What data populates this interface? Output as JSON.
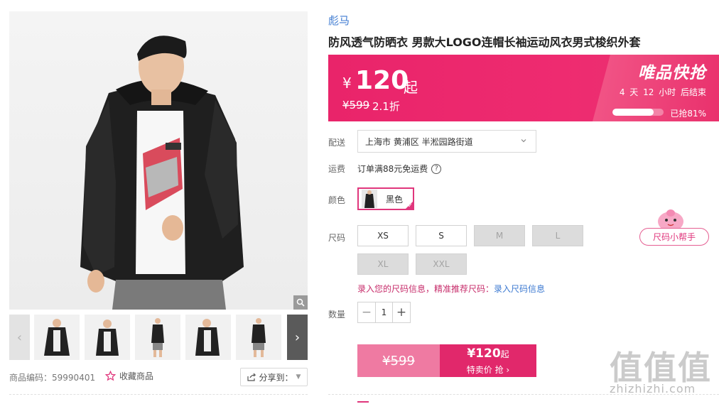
{
  "product": {
    "brand": "彪马",
    "title": "防风透气防晒衣 男款大LOGO连帽长袖运动风衣男式梭织外套"
  },
  "gallery": {
    "sku_label": "商品编码：",
    "sku_code": "59990401",
    "favorite_label": "收藏商品",
    "share_label": "分享到："
  },
  "price": {
    "currency": "¥",
    "amount": "120",
    "suffix": "起",
    "original": "¥599",
    "discount": "2.1折"
  },
  "flash_sale": {
    "title": "唯品快抢",
    "countdown": "4 天 12 小时 后结束",
    "sold_percent": 81,
    "sold_label": "已抢81%"
  },
  "delivery": {
    "label": "配送",
    "value": "上海市 黄浦区 半淞园路街道"
  },
  "shipping": {
    "label": "运费",
    "value": "订单满88元免运费",
    "help": "?"
  },
  "color": {
    "label": "颜色",
    "selected": "黑色"
  },
  "size": {
    "label": "尺码",
    "options": [
      {
        "label": "XS",
        "available": true
      },
      {
        "label": "S",
        "available": true
      },
      {
        "label": "M",
        "available": false
      },
      {
        "label": "L",
        "available": false
      },
      {
        "label": "XL",
        "available": false
      },
      {
        "label": "XXL",
        "available": false
      }
    ],
    "tip_pink": "录入您的尺码信息，精准推荐尺码：",
    "tip_link": "录入尺码信息",
    "helper_label": "尺码小帮手"
  },
  "quantity": {
    "label": "数量",
    "value": "1",
    "minus": "−",
    "plus": "+"
  },
  "buy": {
    "original": "¥599",
    "price": "¥120",
    "price_suffix": "起",
    "action": "特卖价 抢"
  },
  "watermark": {
    "logo": "值值值",
    "url": "zhizhizhi.com"
  },
  "colors": {
    "accent": "#e1286b",
    "brand_link": "#3d7ad1"
  }
}
